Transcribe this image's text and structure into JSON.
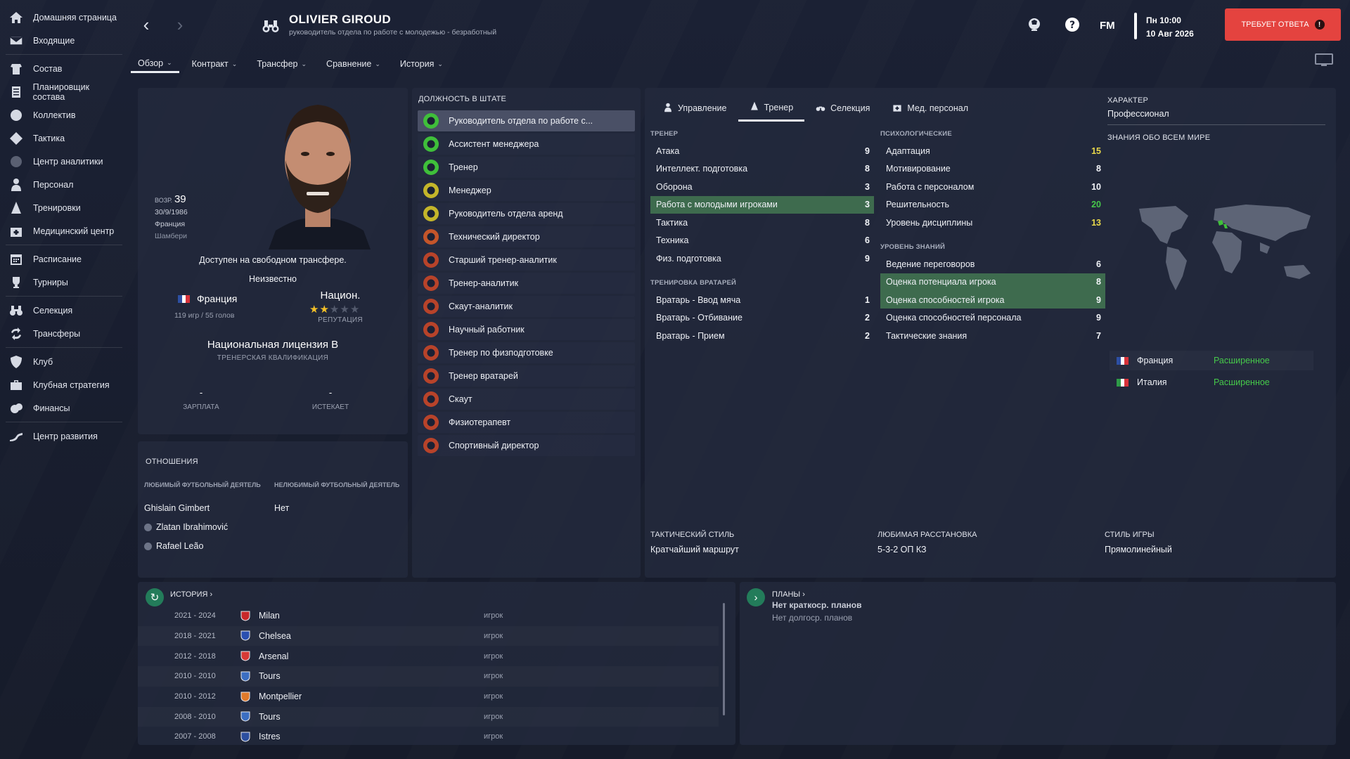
{
  "sidebar": {
    "items": [
      {
        "label": "Домашняя страница",
        "icon": "home-icon"
      },
      {
        "label": "Входящие",
        "icon": "mail-icon"
      },
      {
        "label": "Состав",
        "icon": "squad-icon"
      },
      {
        "label": "Планировщик состава",
        "icon": "planner-icon"
      },
      {
        "label": "Коллектив",
        "icon": "dynamics-icon"
      },
      {
        "label": "Тактика",
        "icon": "tactics-icon"
      },
      {
        "label": "Центр аналитики",
        "icon": "analytics-icon"
      },
      {
        "label": "Персонал",
        "icon": "staff-icon"
      },
      {
        "label": "Тренировки",
        "icon": "training-icon"
      },
      {
        "label": "Медицинский центр",
        "icon": "medical-icon"
      },
      {
        "label": "Расписание",
        "icon": "calendar-icon"
      },
      {
        "label": "Турниры",
        "icon": "trophy-icon"
      },
      {
        "label": "Селекция",
        "icon": "binoculars-icon"
      },
      {
        "label": "Трансферы",
        "icon": "transfers-icon"
      },
      {
        "label": "Клуб",
        "icon": "shield-icon"
      },
      {
        "label": "Клубная стратегия",
        "icon": "briefcase-icon"
      },
      {
        "label": "Финансы",
        "icon": "finance-icon"
      },
      {
        "label": "Центр развития",
        "icon": "development-icon"
      }
    ]
  },
  "header": {
    "name": "OLIVIER GIROUD",
    "subtitle": "руководитель отдела по работе с молодежью - безработный",
    "fm": "FM",
    "day_time": "Пн 10:00",
    "date": "10 Авг 2026",
    "response_button": "ТРЕБУЕТ ОТВЕТА",
    "response_icon": "!",
    "tabs": [
      "Обзор",
      "Контракт",
      "Трансфер",
      "Сравнение",
      "История"
    ]
  },
  "profile": {
    "age_label": "ВОЗР.",
    "age": "39",
    "dob": "30/9/1986",
    "nationality": "Франция",
    "birthplace": "Шамбери",
    "availability": "Доступен на свободном трансфере.",
    "unknown": "Неизвестно",
    "nation_name": "Франция",
    "nation_apps": "119 игр / 55 голов",
    "national_rep_label": "Национ.",
    "reputation_stars": 2,
    "reputation_max": 5,
    "reputation_label": "РЕПУТАЦИЯ",
    "licence": "Национальная лицензия B",
    "licence_label": "ТРЕНЕРСКАЯ КВАЛИФИКАЦИЯ",
    "wage_value": "-",
    "wage_label": "ЗАРПЛАТА",
    "expires_value": "-",
    "expires_label": "ИСТЕКАЕТ"
  },
  "relations": {
    "title": "ОТНОШЕНИЯ",
    "fav_header": "ЛЮБИМЫЙ ФУТБОЛЬНЫЙ ДЕЯТЕЛЬ",
    "unfav_header": "НЕЛЮБИМЫЙ ФУТБОЛЬНЫЙ ДЕЯТЕЛЬ",
    "favourites": [
      "Ghislain Gimbert",
      "Zlatan Ibrahimović",
      "Rafael Leão"
    ],
    "unfavourite": "Нет"
  },
  "staff_roles": {
    "title": "ДОЛЖНОСТЬ В ШТАТЕ",
    "roles": [
      {
        "label": "Руководитель отдела по работе с...",
        "color": "#3fbf3a"
      },
      {
        "label": "Ассистент менеджера",
        "color": "#3fbf3a"
      },
      {
        "label": "Тренер",
        "color": "#3fbf3a"
      },
      {
        "label": "Менеджер",
        "color": "#c4b52a"
      },
      {
        "label": "Руководитель отдела аренд",
        "color": "#c4b52a"
      },
      {
        "label": "Технический директор",
        "color": "#c4552a"
      },
      {
        "label": "Старший тренер-аналитик",
        "color": "#b8432a"
      },
      {
        "label": "Тренер-аналитик",
        "color": "#b8432a"
      },
      {
        "label": "Скаут-аналитик",
        "color": "#b8432a"
      },
      {
        "label": "Научный работник",
        "color": "#b8432a"
      },
      {
        "label": "Тренер по физподготовке",
        "color": "#b8432a"
      },
      {
        "label": "Тренер вратарей",
        "color": "#b8432a"
      },
      {
        "label": "Скаут",
        "color": "#b8432a"
      },
      {
        "label": "Физиотерапевт",
        "color": "#b8432a"
      },
      {
        "label": "Спортивный директор",
        "color": "#b8432a"
      }
    ]
  },
  "attributes": {
    "tabs": [
      {
        "label": "Управление",
        "icon": "manager-icon"
      },
      {
        "label": "Тренер",
        "icon": "coach-icon"
      },
      {
        "label": "Селекция",
        "icon": "binoculars-icon"
      },
      {
        "label": "Мед. персонал",
        "icon": "medical-icon"
      }
    ],
    "coaching_title": "ТРЕНЕР",
    "coaching": [
      {
        "name": "Атака",
        "value": "9"
      },
      {
        "name": "Интеллект. подготовка",
        "value": "8"
      },
      {
        "name": "Оборона",
        "value": "3"
      },
      {
        "name": "Работа с молодыми игроками",
        "value": "3"
      },
      {
        "name": "Тактика",
        "value": "8"
      },
      {
        "name": "Техника",
        "value": "6"
      },
      {
        "name": "Физ. подготовка",
        "value": "9"
      }
    ],
    "gk_title": "ТРЕНИРОВКА ВРАТАРЕЙ",
    "gk": [
      {
        "name": "Вратарь - Ввод мяча",
        "value": "1"
      },
      {
        "name": "Вратарь - Отбивание",
        "value": "2"
      },
      {
        "name": "Вратарь - Прием",
        "value": "2"
      }
    ],
    "mental_title": "ПСИХОЛОГИЧЕСКИЕ",
    "mental": [
      {
        "name": "Адаптация",
        "value": "15"
      },
      {
        "name": "Мотивирование",
        "value": "8"
      },
      {
        "name": "Работа с персоналом",
        "value": "10"
      },
      {
        "name": "Решительность",
        "value": "20"
      },
      {
        "name": "Уровень дисциплины",
        "value": "13"
      }
    ],
    "knowledge_title": "УРОВЕНЬ ЗНАНИЙ",
    "knowledge": [
      {
        "name": "Ведение переговоров",
        "value": "6"
      },
      {
        "name": "Оценка потенциала игрока",
        "value": "8"
      },
      {
        "name": "Оценка способностей игрока",
        "value": "9"
      },
      {
        "name": "Оценка способностей персонала",
        "value": "9"
      },
      {
        "name": "Тактические знания",
        "value": "7"
      }
    ],
    "character_title": "ХАРАКТЕР",
    "character": "Профессионал",
    "world_title": "ЗНАНИЯ ОБО ВСЕМ МИРЕ",
    "languages": [
      {
        "country": "Франция",
        "level": "Расширенное"
      },
      {
        "country": "Италия",
        "level": "Расширенное"
      }
    ],
    "tactical_style_label": "ТАКТИЧЕСКИЙ СТИЛЬ",
    "tactical_style": "Кратчайший маршрут",
    "formation_label": "ЛЮБИМАЯ РАССТАНОВКА",
    "formation": "5-3-2 ОП КЗ",
    "play_style_label": "СТИЛЬ ИГРЫ",
    "play_style": "Прямолинейный"
  },
  "history": {
    "title": "ИСТОРИЯ",
    "rows": [
      {
        "years": "2021 - 2024",
        "club": "Milan",
        "role": "игрок",
        "color": "#c8282a"
      },
      {
        "years": "2018 - 2021",
        "club": "Chelsea",
        "role": "игрок",
        "color": "#2a4fb0"
      },
      {
        "years": "2012 - 2018",
        "club": "Arsenal",
        "role": "игрок",
        "color": "#d83a36"
      },
      {
        "years": "2010 - 2010",
        "club": "Tours",
        "role": "игрок",
        "color": "#3b6ec2"
      },
      {
        "years": "2010 - 2012",
        "club": "Montpellier",
        "role": "игрок",
        "color": "#e07a2a"
      },
      {
        "years": "2008 - 2010",
        "club": "Tours",
        "role": "игрок",
        "color": "#3b6ec2"
      },
      {
        "years": "2007 - 2008",
        "club": "Istres",
        "role": "игрок",
        "color": "#2c4fa0"
      }
    ]
  },
  "plans": {
    "title": "ПЛАНЫ",
    "short": "Нет краткоср. планов",
    "long": "Нет долгоср. планов"
  }
}
